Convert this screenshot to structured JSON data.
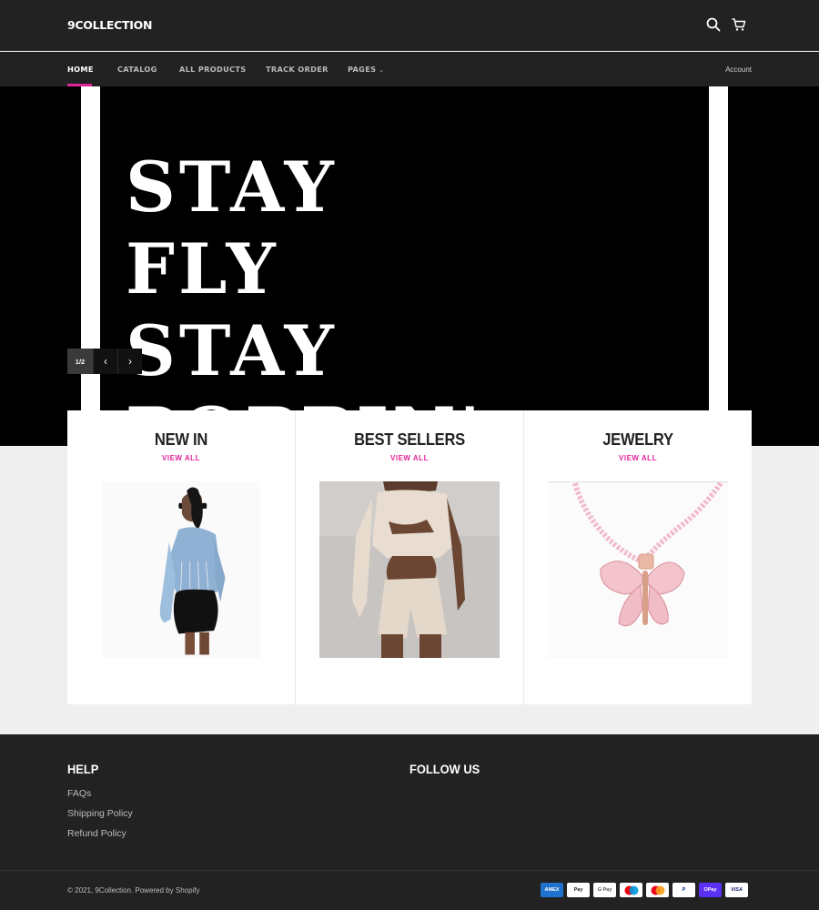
{
  "header": {
    "logo": "9COLLECTION",
    "search_icon": "search-icon",
    "cart_icon": "cart-icon"
  },
  "nav": {
    "items": [
      {
        "label": "HOME",
        "active": true
      },
      {
        "label": "CATALOG",
        "active": false
      },
      {
        "label": "ALL PRODUCTS",
        "active": false
      },
      {
        "label": "TRACK ORDER",
        "active": false
      },
      {
        "label": "PAGES",
        "active": false,
        "has_dropdown": true
      }
    ],
    "account": "Account",
    "accent_color": "#e0249a"
  },
  "hero": {
    "lines": [
      "STAY",
      "FLY",
      "STAY",
      "POPPIN'"
    ],
    "slide_counter": "1/2",
    "prev_icon": "chevron-left-icon",
    "next_icon": "chevron-right-icon"
  },
  "collections": [
    {
      "title": "NEW IN",
      "link": "VIEW ALL",
      "image": "denim-jacket-model-image"
    },
    {
      "title": "BEST SELLERS",
      "link": "VIEW ALL",
      "image": "cutout-romper-model-image"
    },
    {
      "title": "JEWELRY",
      "link": "VIEW ALL",
      "image": "butterfly-necklace-image"
    }
  ],
  "footer": {
    "help_heading": "HELP",
    "follow_heading": "FOLLOW US",
    "links": [
      "FAQs",
      "Shipping Policy",
      "Refund Policy"
    ],
    "copyright": "© 2021, 9Collection. Powered by Shopify",
    "payment_methods": [
      "AMEX",
      "Pay",
      "G Pay",
      "Maestro",
      "Mastercard",
      "PayPal",
      "OPay",
      "VISA"
    ]
  },
  "colors": {
    "header_bg": "#222222",
    "accent": "#e0249a",
    "page_bg": "#efefef"
  }
}
